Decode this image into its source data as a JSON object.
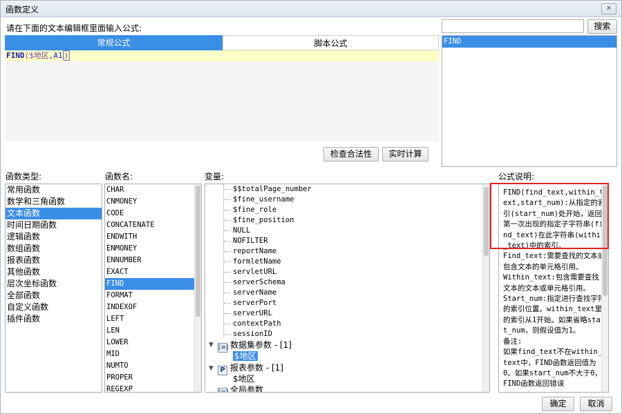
{
  "window": {
    "title": "函数定义",
    "close_glyph": "✕"
  },
  "prompt_label": "请在下面的文本编辑框里面输入公式:",
  "tabs": [
    {
      "label": "常规公式",
      "active": true
    },
    {
      "label": "脚本公式",
      "active": false
    }
  ],
  "formula": {
    "fn": "FIND",
    "open": "(",
    "arg1": "$地区",
    "comma": ",",
    "arg2": "A1",
    "close": ")"
  },
  "search": {
    "value": "",
    "button": "搜索"
  },
  "search_result": {
    "items": [
      "FIND"
    ]
  },
  "buttons": {
    "check": "检查合法性",
    "realtime": "实时计算",
    "ok": "确定",
    "cancel": "取消"
  },
  "headers": {
    "func_type": "函数类型:",
    "func_name": "函数名:",
    "variables": "变量:",
    "description": "公式说明:"
  },
  "func_types": [
    "常用函数",
    "数学和三角函数",
    "文本函数",
    "时间日期函数",
    "逻辑函数",
    "数组函数",
    "报表函数",
    "其他函数",
    "层次坐标函数",
    "全部函数",
    "自定义函数",
    "插件函数"
  ],
  "func_types_selected": 2,
  "func_names": [
    "CHAR",
    "CNMONEY",
    "CODE",
    "CONCATENATE",
    "ENDWITH",
    "ENMONEY",
    "ENNUMBER",
    "EXACT",
    "FIND",
    "FORMAT",
    "INDEXOF",
    "LEFT",
    "LEN",
    "LOWER",
    "MID",
    "NUMTO",
    "PROPER",
    "REGEXP"
  ],
  "func_names_selected": 8,
  "variables": [
    "$$totalPage_number",
    "$fine_username",
    "$fine_role",
    "$fine_position",
    "NULL",
    "NOFILTER",
    "reportName",
    "formletName",
    "servletURL",
    "serverSchema",
    "serverName",
    "serverPort",
    "serverURL",
    "contextPath",
    "sessionID"
  ],
  "tree": {
    "dataset_node": "数据集参数 - [1]",
    "dataset_child": "$地区",
    "report_node": "报表参数 - [1]",
    "report_child": "$地区",
    "global_node": "全局参数",
    "report_icon": "P",
    "param_icon": "[≡]",
    "expand_glyph": "▼"
  },
  "description": "FIND(find_text,within_text,start_num):从指定的索引(start_num)处开始，返回第一次出现的指定子字符串(find_text)在此字符串(within_text)中的索引。\nFind_text:需要查找的文本或包含文本的单元格引用。\nWithin_text:包含需要查找文本的文本或单元格引用。\nStart_num:指定进行查找字符的索引位置。within_text里的索引从1开始。如果省略start_num，则假设值为1。\n备注:\n如果find_text不在within_text中，FIND函数返回值为0。如果start_num不大于0，FIND函数返回错误"
}
